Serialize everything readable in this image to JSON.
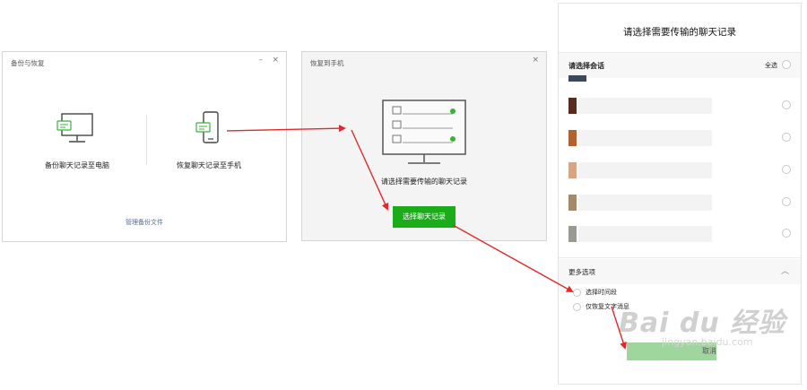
{
  "backup_window": {
    "title": "备份与恢复",
    "minimize": "–",
    "close": "×",
    "option_pc": "备份聊天记录至电脑",
    "option_phone": "恢复聊天记录至手机",
    "manage_link": "管理备份文件"
  },
  "restore_window": {
    "title": "恢复到手机",
    "close": "×",
    "caption": "请选择需要传输的聊天记录",
    "button": "选择聊天记录"
  },
  "select_panel": {
    "title": "请选择需要传输的聊天记录",
    "section_label": "请选择会话",
    "select_all": "全选",
    "more_options": "更多选项",
    "options": [
      "选择时间段",
      "仅恢复文字消息"
    ],
    "cancel": "取消"
  },
  "watermark": {
    "main": "Bai du 经验",
    "sub": "jingyan.baidu.com"
  },
  "colors": {
    "accent_green": "#1aad19",
    "arrow_red": "#e8262a",
    "link_blue": "#576b95"
  }
}
